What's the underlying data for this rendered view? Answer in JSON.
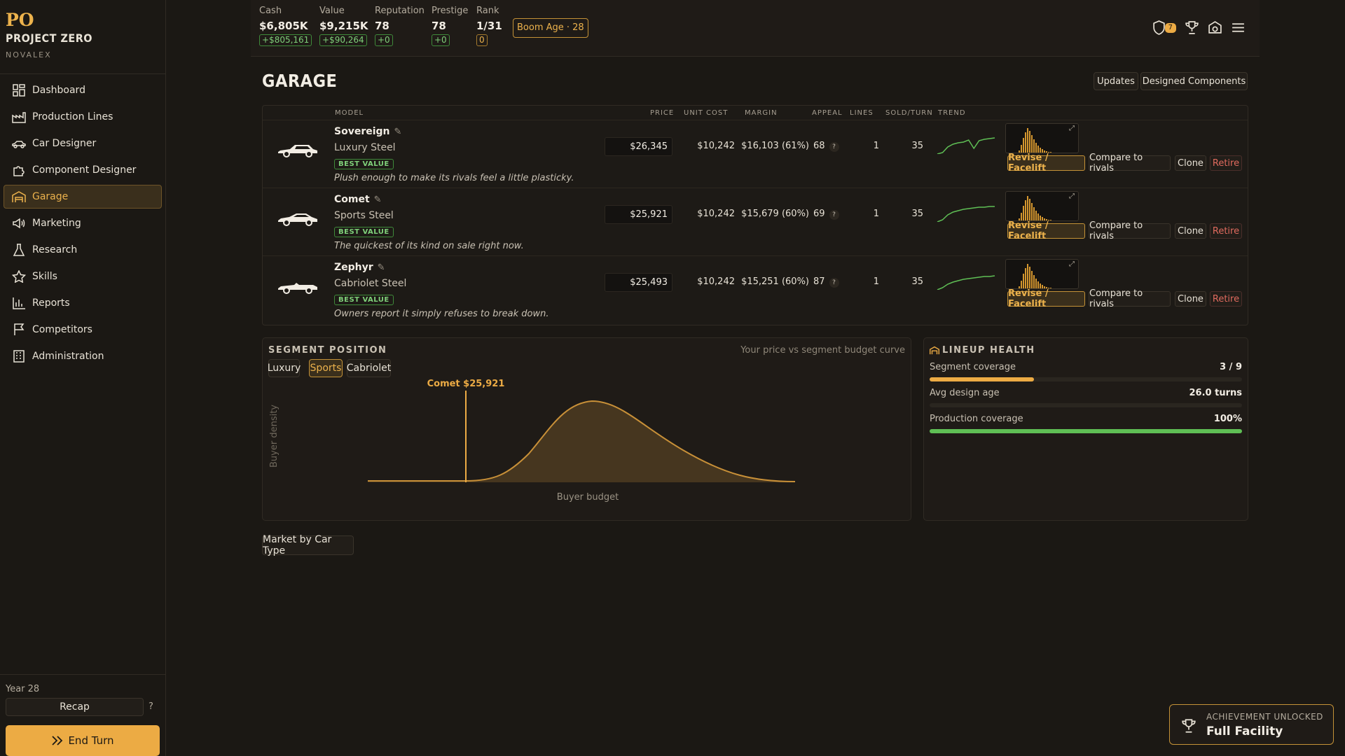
{
  "app": {
    "logo_short": "PO",
    "name": "PROJECT ZERO",
    "company": "NOVALEX"
  },
  "nav": [
    {
      "label": "Dashboard",
      "icon": "dashboard-icon"
    },
    {
      "label": "Production Lines",
      "icon": "factory-icon"
    },
    {
      "label": "Car Designer",
      "icon": "car-icon"
    },
    {
      "label": "Component Designer",
      "icon": "puzzle-icon"
    },
    {
      "label": "Garage",
      "icon": "garage-icon",
      "active": true
    },
    {
      "label": "Marketing",
      "icon": "megaphone-icon"
    },
    {
      "label": "Research",
      "icon": "flask-icon"
    },
    {
      "label": "Skills",
      "icon": "star-icon"
    },
    {
      "label": "Reports",
      "icon": "bar-chart-icon"
    },
    {
      "label": "Competitors",
      "icon": "flag-icon"
    },
    {
      "label": "Administration",
      "icon": "building-icon"
    }
  ],
  "footer": {
    "year": "Year 28",
    "recap": "Recap",
    "help": "?",
    "end_turn": "End Turn"
  },
  "stats": {
    "cash": {
      "label": "Cash",
      "value": "$6,805K",
      "delta": "+$805,161"
    },
    "value": {
      "label": "Value",
      "value": "$9,215K",
      "delta": "+$90,264"
    },
    "reputation": {
      "label": "Reputation",
      "value": "78",
      "delta": "+0"
    },
    "prestige": {
      "label": "Prestige",
      "value": "78",
      "delta": "+0"
    },
    "rank": {
      "label": "Rank",
      "value": "1/31",
      "delta": "0"
    },
    "boom": "Boom Age · 28"
  },
  "top_icons": {
    "shield_badge": "7"
  },
  "page": {
    "title": "GARAGE",
    "updates": "Updates",
    "designed_components": "Designed Components"
  },
  "table": {
    "headers": {
      "model": "MODEL",
      "price": "PRICE",
      "unit_cost": "UNIT COST",
      "margin": "MARGIN",
      "appeal": "APPEAL",
      "lines": "LINES",
      "sold": "SOLD/TURN",
      "trend": "TREND"
    },
    "rows": [
      {
        "name": "Sovereign",
        "type": "Luxury Steel",
        "badge": "BEST VALUE",
        "desc": "Plush enough to make its rivals feel a little plasticky.",
        "price": "$26,345",
        "unit_cost": "$10,242",
        "margin": "$16,103 (61%)",
        "appeal": "68",
        "appeal_help": "?",
        "lines": "1",
        "sold": "35",
        "trend": [
          30,
          28,
          20,
          16,
          14,
          13,
          10,
          22,
          11,
          9,
          8,
          7
        ]
      },
      {
        "name": "Comet",
        "type": "Sports Steel",
        "badge": "BEST VALUE",
        "desc": "The quickest of its kind on sale right now.",
        "price": "$25,921",
        "unit_cost": "$10,242",
        "margin": "$15,679 (60%)",
        "appeal": "69",
        "appeal_help": "?",
        "lines": "1",
        "sold": "35",
        "trend": [
          30,
          27,
          20,
          16,
          14,
          12,
          11,
          10,
          9,
          9,
          8,
          8
        ]
      },
      {
        "name": "Zephyr",
        "type": "Cabriolet Steel",
        "badge": "BEST VALUE",
        "desc": "Owners report it simply refuses to break down.",
        "price": "$25,493",
        "unit_cost": "$10,242",
        "margin": "$15,251 (60%)",
        "appeal": "87",
        "appeal_help": "?",
        "lines": "1",
        "sold": "35",
        "trend": [
          30,
          27,
          22,
          19,
          17,
          15,
          14,
          13,
          12,
          11,
          11,
          10
        ]
      }
    ],
    "actions": {
      "revise": "Revise / Facelift",
      "compare": "Compare to rivals",
      "clone": "Clone",
      "retire": "Retire"
    }
  },
  "segment": {
    "title": "SEGMENT POSITION",
    "subtitle": "Your price vs segment budget curve",
    "tabs": [
      "Luxury",
      "Sports",
      "Cabriolet"
    ],
    "active_tab": "Sports",
    "marker_label": "Comet $25,921",
    "xlabel": "Buyer budget",
    "ylabel": "Buyer density"
  },
  "lineup": {
    "title": "LINEUP HEALTH",
    "items": [
      {
        "label": "Segment coverage",
        "value": "3 / 9",
        "fraction": 0.333,
        "color": "#ecab44"
      },
      {
        "label": "Avg design age",
        "value": "26.0 turns",
        "fraction": 0,
        "color": "#ecab44"
      },
      {
        "label": "Production coverage",
        "value": "100%",
        "fraction": 1.0,
        "color": "#5fbf55"
      }
    ]
  },
  "market_button": "Market by Car Type",
  "toast": {
    "title": "ACHIEVEMENT UNLOCKED",
    "name": "Full Facility"
  },
  "colors": {
    "accent": "#ecab44",
    "positive": "#7fd07a",
    "danger": "#e06a5e",
    "background": "#1b1814"
  }
}
